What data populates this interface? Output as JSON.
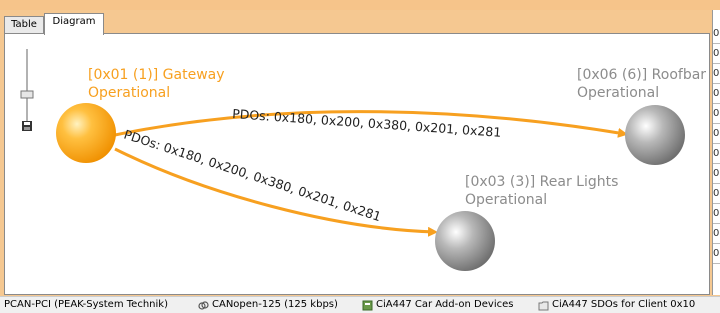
{
  "tabs": [
    {
      "label": "Table",
      "active": false
    },
    {
      "label": "Diagram",
      "active": true
    }
  ],
  "nodes": [
    {
      "id": "gateway",
      "title": "[0x01 (1)] Gateway",
      "state": "Operational",
      "color": "#f7a020"
    },
    {
      "id": "roofbar",
      "title": "[0x06 (6)] Roofbar",
      "state": "Operational",
      "color": "#8c8c8c"
    },
    {
      "id": "rear-lights",
      "title": "[0x03 (3)] Rear Lights",
      "state": "Operational",
      "color": "#8c8c8c"
    }
  ],
  "edges": [
    {
      "from": "gateway",
      "to": "roofbar",
      "label": "PDOs: 0x180, 0x200, 0x380, 0x201, 0x281"
    },
    {
      "from": "gateway",
      "to": "rear-lights",
      "label": "PDOs: 0x180, 0x200, 0x380, 0x201, 0x281"
    }
  ],
  "right_panel_cells": [
    "0",
    "0",
    "0",
    "0",
    "0",
    "0",
    "0",
    "0",
    "0",
    "0",
    "0",
    "0"
  ],
  "status_bar": [
    {
      "icon": "network-icon",
      "text": "PCAN-PCI (PEAK-System Technik)"
    },
    {
      "icon": "link-icon",
      "text": "CANopen-125 (125 kbps)"
    },
    {
      "icon": "device-icon",
      "text": "CiA447 Car Add-on Devices"
    },
    {
      "icon": "folder-icon",
      "text": "CiA447 SDOs for Client 0x10"
    }
  ],
  "colors": {
    "accent": "#f7a020",
    "node_gray": "#8c8c8c",
    "edge": "#f7a020"
  }
}
